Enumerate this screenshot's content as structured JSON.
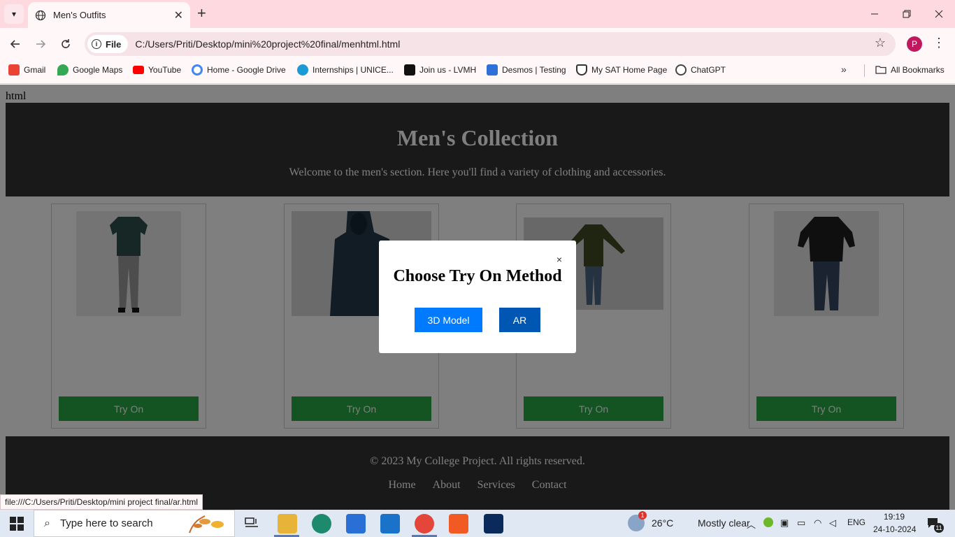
{
  "browser": {
    "tab_title": "Men's Outfits",
    "tab_close": "✕",
    "new_tab": "+",
    "site_chip": "File",
    "url": "C:/Users/Priti/Desktop/mini%20project%20final/menhtml.html",
    "profile_initial": "P",
    "bookmarks": [
      {
        "label": "Gmail",
        "color": "#ea4335"
      },
      {
        "label": "Google Maps",
        "color": "#34a853"
      },
      {
        "label": "YouTube",
        "color": "#ff0000"
      },
      {
        "label": "Home - Google Drive",
        "color": "#4285f4"
      },
      {
        "label": "Internships | UNICE...",
        "color": "#1c9ad6"
      },
      {
        "label": "Join us - LVMH",
        "color": "#111111"
      },
      {
        "label": "Desmos | Testing",
        "color": "#2f6fd8"
      },
      {
        "label": "My SAT Home Page",
        "color": "#333333"
      },
      {
        "label": "ChatGPT",
        "color": "#444444"
      }
    ],
    "all_bookmarks": "All Bookmarks",
    "more_bookmarks": "»"
  },
  "page": {
    "stray_text": "html",
    "header": {
      "title": "Men's Collection",
      "subtitle": "Welcome to the men's section. Here you'll find a variety of clothing and accessories."
    },
    "products": [
      {
        "button": "Try On",
        "image": "polo-shirt-outfit-image"
      },
      {
        "button": "Try On",
        "image": "hoodie-image"
      },
      {
        "button": "Try On",
        "image": "flannel-jacket-outfit-image"
      },
      {
        "button": "Try On",
        "image": "black-hoodie-jeans-outfit-image"
      }
    ],
    "footer": {
      "copyright": "© 2023 My College Project. All rights reserved.",
      "links": [
        "Home",
        "About",
        "Services",
        "Contact"
      ]
    }
  },
  "modal": {
    "title": "Choose Try On Method",
    "close": "×",
    "btn_3d": "3D Model",
    "btn_ar": "AR",
    "btn_3d_color": "#007bff",
    "btn_ar_color": "#0056b3"
  },
  "status_bar": {
    "url": "file:///C:/Users/Priti/Desktop/mini project final/ar.html"
  },
  "taskbar": {
    "search_placeholder": "Type here to search",
    "weather_temp": "26°C",
    "weather_text": "Mostly clear",
    "weather_badge": "1",
    "lang": "ENG",
    "time": "19:19",
    "date": "24-10-2024",
    "notification_count": "11"
  },
  "colors": {
    "tab_strip": "#ffd9e0",
    "header_bg": "#333333",
    "try_on": "#28a745"
  }
}
